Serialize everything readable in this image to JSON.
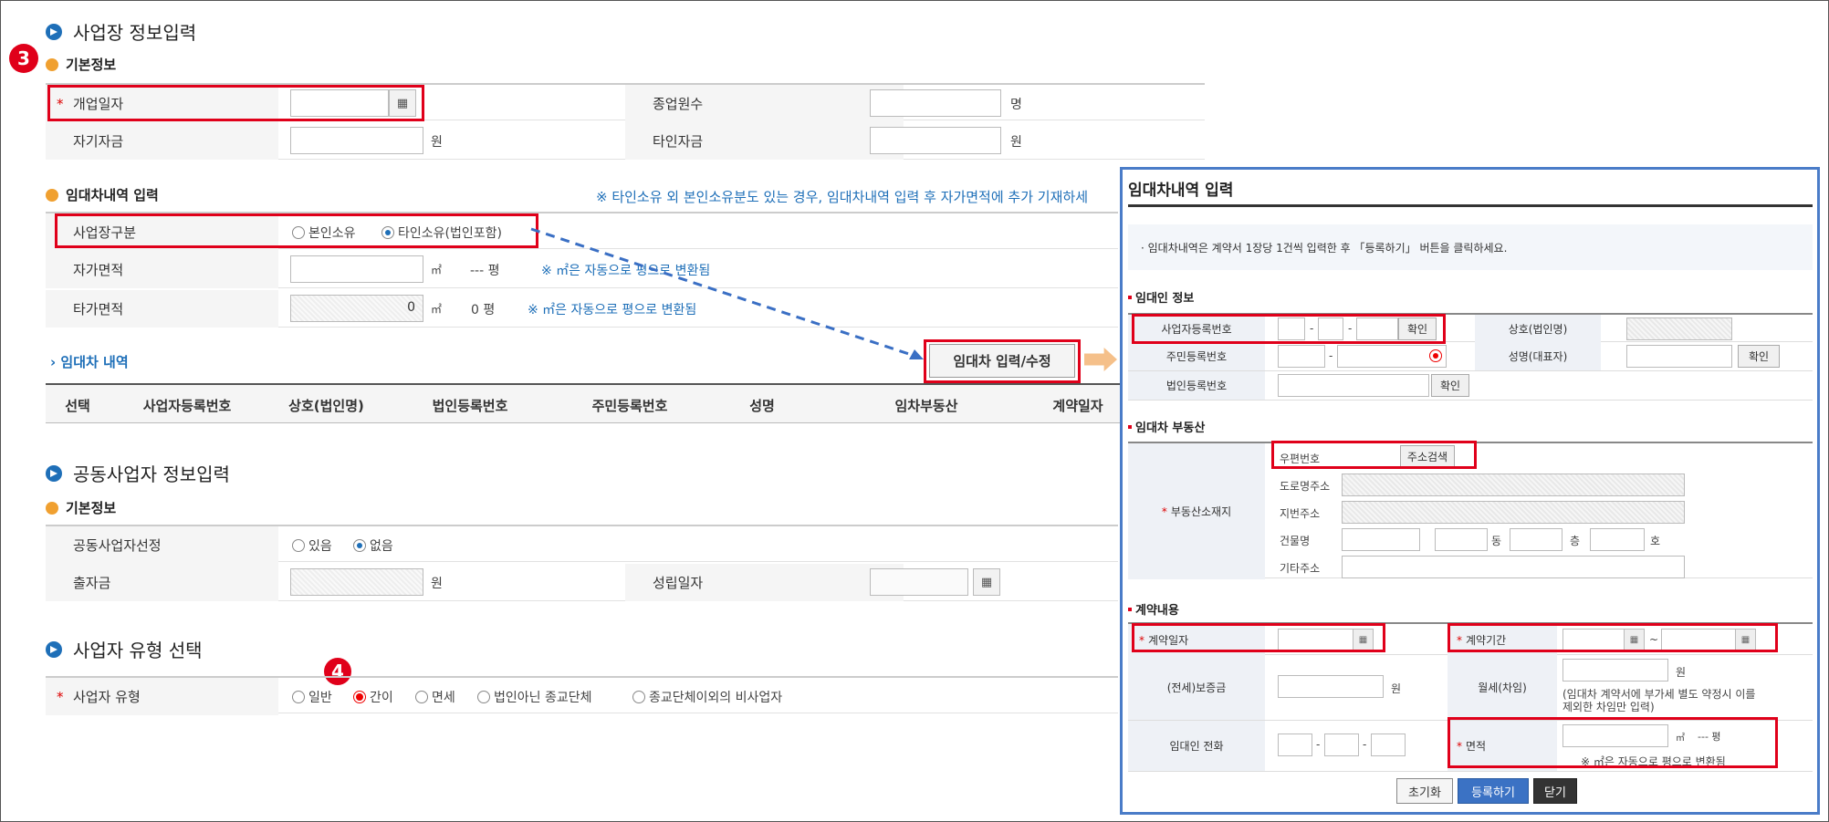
{
  "section1": {
    "title": "사업장 정보입력"
  },
  "badge3": "3",
  "badge4": "4",
  "basic": {
    "title": "기본정보",
    "open_date": "개업일자",
    "employees": "종업원수",
    "employees_unit": "명",
    "own_capital": "자기자금",
    "own_capital_unit": "원",
    "other_capital": "타인자금",
    "other_capital_unit": "원"
  },
  "lease_input": {
    "title": "임대차내역 입력",
    "notice": "※ 타인소유 외 본인소유분도 있는 경우, 임대차내역 입력 후 자가면적에 추가 기재하세",
    "type_label": "사업장구분",
    "opt_self": "본인소유",
    "opt_other": "타인소유(법인포함)",
    "own_area": "자가면적",
    "own_area_unit": "㎡",
    "own_area_pyeong": "--- 평",
    "own_area_note": "※ ㎡은 자동으로 평으로 변환됨",
    "other_area": "타가면적",
    "other_area_value": "0",
    "other_area_unit": "㎡",
    "other_area_pyeong": "0 평",
    "other_area_note": "※ ㎡은 자동으로 평으로 변환됨"
  },
  "lease_list": {
    "title": "임대차 내역",
    "edit_button": "임대차 입력/수정",
    "columns": [
      "선택",
      "사업자등록번호",
      "상호(법인명)",
      "법인등록번호",
      "주민등록번호",
      "성명",
      "임차부동산",
      "계약일자"
    ]
  },
  "section2": {
    "title": "공동사업자 정보입력"
  },
  "partner": {
    "title": "기본정보",
    "select_label": "공동사업자선정",
    "opt_yes": "있음",
    "opt_no": "없음",
    "investment": "출자금",
    "investment_unit": "원",
    "est_date": "성립일자"
  },
  "section3": {
    "title": "사업자 유형 선택"
  },
  "biztype": {
    "label": "사업자 유형",
    "options": [
      "일반",
      "간이",
      "면세",
      "법인아닌 종교단체",
      "종교단체이외의 비사업자"
    ]
  },
  "popup": {
    "title": "임대차내역 입력",
    "notice": "· 임대차내역은 계약서 1장당 1건씩 입력한 후 「등록하기」 버튼을 클릭하세요.",
    "lessor_section": "임대인 정보",
    "brn": "사업자등록번호",
    "confirm": "확인",
    "company": "상호(법인명)",
    "rrn": "주민등록번호",
    "name": "성명(대표자)",
    "crn": "법인등록번호",
    "property_section": "임대차 부동산",
    "location": "부동산소재지",
    "zipcode": "우편번호",
    "addr_search": "주소검색",
    "road_addr": "도로명주소",
    "lot_addr": "지번주소",
    "building": "건물명",
    "dong": "동",
    "floor": "층",
    "ho": "호",
    "etc_addr": "기타주소",
    "contract_section": "계약내용",
    "contract_date": "계약일자",
    "contract_period": "계약기간",
    "tilde": "~",
    "deposit": "(전세)보증금",
    "deposit_unit": "원",
    "monthly": "월세(차임)",
    "monthly_unit": "원",
    "monthly_note": "(임대차 계약서에 부가세 별도 약정시 이를 제외한 차임만 입력)",
    "phone": "임대인 전화",
    "area": "면적",
    "area_unit": "㎡",
    "area_pyeong": "--- 평",
    "area_note": "※ ㎡은 자동으로 평으로 변환됨",
    "btn_reset": "초기화",
    "btn_register": "등록하기",
    "btn_close": "닫기"
  }
}
